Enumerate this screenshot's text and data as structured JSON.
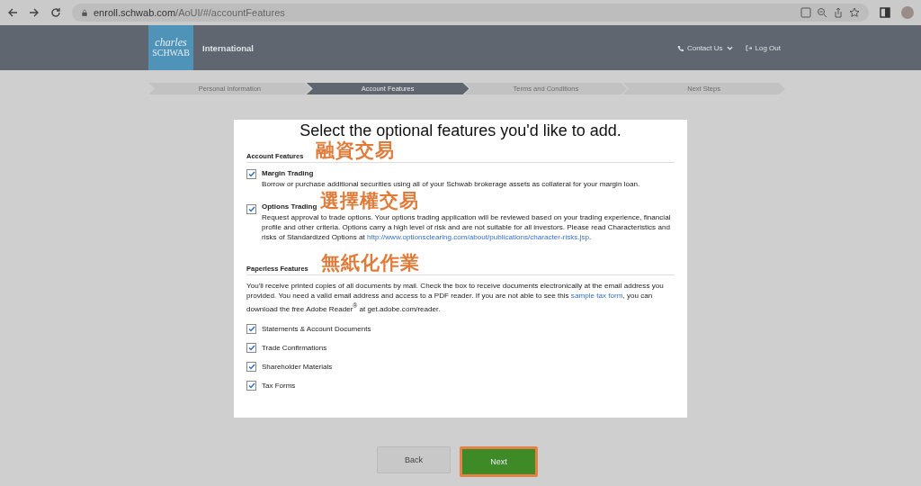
{
  "browser": {
    "url_host": "enroll.schwab.com",
    "url_path": "/AoUI/#/accountFeatures"
  },
  "header": {
    "logo": [
      "charles",
      "SCHWAB"
    ],
    "title": "International",
    "contact": "Contact Us",
    "logout": "Log Out"
  },
  "steps": [
    {
      "label": "Personal Information",
      "selected": false
    },
    {
      "label": "Account Features",
      "selected": true
    },
    {
      "label": "Terms and Conditions",
      "selected": false
    },
    {
      "label": "Next Steps",
      "selected": false
    }
  ],
  "card": {
    "heading": "Select the optional features you'd like to add.",
    "account_section": {
      "title": "Account Features",
      "annotation": "融資交易",
      "options": [
        {
          "label": "Margin Trading",
          "checked": true,
          "description": "Borrow or purchase additional securities using all of your Schwab brokerage assets as collateral for your margin loan."
        },
        {
          "label": "Options Trading",
          "checked": true,
          "annotation": "選擇權交易",
          "description": "Request approval to trade options. Your options trading application will be reviewed based on your trading experience, financial profile and other criteria. Options carry a high level of risk and are not suitable for all investors. Please read Characteristics and risks of Standardized Options at",
          "link": "http://www.optionsclearing.com/about/publications/character-risks.jsp",
          "after_link": "."
        }
      ]
    },
    "paperless_section": {
      "title": "Paperless Features",
      "annotation": "無紙化作業",
      "intro_before": "You'll receive printed copies of all documents by mail. Check the box to receive documents electronically at the email address you provided. You need a valid email address and access to a PDF reader. If you are not able to see this",
      "intro_link": "sample tax form",
      "intro_after": ", you can download the free Adobe Reader$^{®}$ at get.adobe.com/reader.",
      "options": [
        {
          "label": "Statements & Account Documents",
          "checked": true
        },
        {
          "label": "Trade Confirmations",
          "checked": true
        },
        {
          "label": "Shareholder Materials",
          "checked": true
        },
        {
          "label": "Tax Forms",
          "checked": true
        }
      ]
    }
  },
  "buttons": {
    "back": "Back",
    "next": "Next"
  }
}
